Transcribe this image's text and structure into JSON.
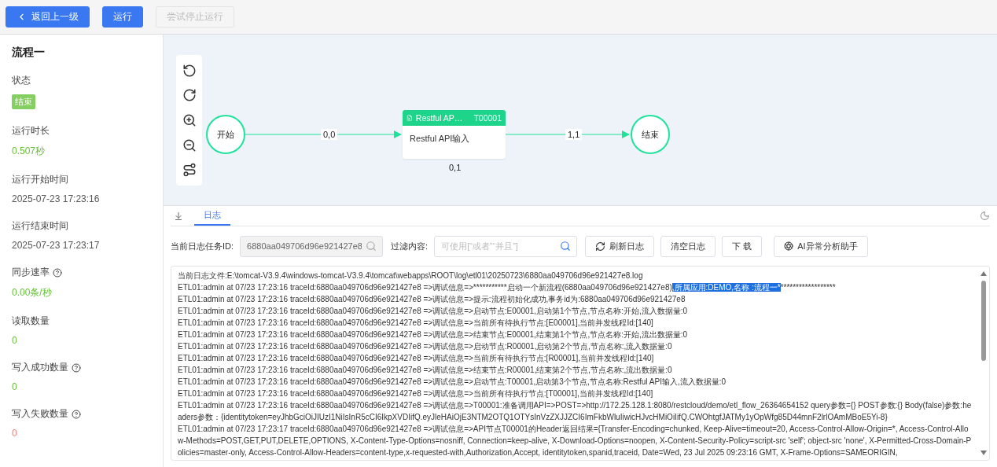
{
  "toolbar": [
    {
      "label": "返回上一级",
      "kind": "back",
      "disabled": false
    },
    {
      "label": "运行",
      "kind": "primary",
      "disabled": false
    },
    {
      "label": "尝试停止运行",
      "kind": "plain",
      "disabled": true
    }
  ],
  "flow": {
    "title": "流程一",
    "stats": [
      {
        "label": "状态",
        "help": false,
        "kind": "tag",
        "value": "结束",
        "color": "#85ce61"
      },
      {
        "label": "运行时长",
        "help": false,
        "kind": "value",
        "value": "0.507秒",
        "color": "#67c23a"
      },
      {
        "label": "运行开始时间",
        "help": false,
        "kind": "value",
        "value": "2025-07-23 17:23:16",
        "color": "#555555"
      },
      {
        "label": "运行结束时间",
        "help": false,
        "kind": "value",
        "value": "2025-07-23 17:23:17",
        "color": "#555555"
      },
      {
        "label": "同步速率",
        "help": true,
        "kind": "value",
        "value": "0.00条/秒",
        "color": "#67c23a"
      },
      {
        "label": "读取数量",
        "help": false,
        "kind": "value",
        "value": "0",
        "color": "#67c23a"
      },
      {
        "label": "写入成功数量",
        "help": true,
        "kind": "value",
        "value": "0",
        "color": "#67c23a"
      },
      {
        "label": "写入失败数量",
        "help": true,
        "kind": "value",
        "value": "0",
        "color": "#f08080"
      }
    ]
  },
  "graph": {
    "nodes": [
      {
        "kind": "start",
        "label": "开始"
      },
      {
        "kind": "task",
        "title": "Restful AP…",
        "code": "T00001",
        "body": "Restful API输入",
        "caption": "0,1"
      },
      {
        "kind": "end",
        "label": "结束"
      }
    ],
    "edges": [
      {
        "label": "0,0"
      },
      {
        "label": "1,1"
      }
    ]
  },
  "log_panel": {
    "tabs": [
      {
        "label": "日志",
        "selected": true
      }
    ],
    "task_id": {
      "label": "当前日志任务ID:",
      "value": "6880aa049706d96e921427e8",
      "disabled": true
    },
    "filter": {
      "label": "过滤内容:",
      "placeholder": "可使用[“或者”“并且”]"
    },
    "actions": [
      {
        "label": "刷新日志",
        "kind": "refresh"
      },
      {
        "label": "清空日志",
        "kind": "plain"
      },
      {
        "label": "下 载",
        "kind": "plain"
      },
      {
        "label": "AI异常分析助手",
        "kind": "ai"
      }
    ],
    "lines": [
      [
        {
          "text": "当前日志文件:E:\\tomcat-V3.9.4\\windows-tomcat-V3.9.4\\tomcat\\webapps\\ROOT\\log\\etl01\\20250723\\6880aa049706d96e921427e8.log",
          "selected": false
        }
      ],
      [
        {
          "text": "ETL01:admin at 07/23 17:23:16 traceId:6880aa049706d96e921427e8 =>调试信息=>***********启动一个新流程(6880aa049706d96e921427e8)",
          "selected": false
        },
        {
          "text": ",所属应用:DEMO,名称 :流程一*",
          "selected": true
        },
        {
          "text": "******************",
          "selected": false
        }
      ],
      [
        {
          "text": "ETL01:admin at 07/23 17:23:16 traceId:6880aa049706d96e921427e8 =>调试信息=>提示:流程初始化成功,事务id为:6880aa049706d96e921427e8",
          "selected": false
        }
      ],
      [
        {
          "text": "ETL01:admin at 07/23 17:23:16 traceId:6880aa049706d96e921427e8 =>调试信息=>启动节点:E00001,启动第1个节点,节点名称:开始,流入数据量:0",
          "selected": false
        }
      ],
      [
        {
          "text": "ETL01:admin at 07/23 17:23:16 traceId:6880aa049706d96e921427e8 =>调试信息=>当前所有待执行节点:[E00001],当前并发线程Id:[140]",
          "selected": false
        }
      ],
      [
        {
          "text": "ETL01:admin at 07/23 17:23:16 traceId:6880aa049706d96e921427e8 =>调试信息=>结束节点:E00001,结束第1个节点,节点名称:开始,流出数据量:0",
          "selected": false
        }
      ],
      [
        {
          "text": "ETL01:admin at 07/23 17:23:16 traceId:6880aa049706d96e921427e8 =>调试信息=>启动节点:R00001,启动第2个节点,节点名称:,流入数据量:0",
          "selected": false
        }
      ],
      [
        {
          "text": "ETL01:admin at 07/23 17:23:16 traceId:6880aa049706d96e921427e8 =>调试信息=>当前所有待执行节点:[R00001],当前并发线程Id:[140]",
          "selected": false
        }
      ],
      [
        {
          "text": "ETL01:admin at 07/23 17:23:16 traceId:6880aa049706d96e921427e8 =>调试信息=>结束节点:R00001,结束第2个节点,节点名称:,流出数据量:0",
          "selected": false
        }
      ],
      [
        {
          "text": "ETL01:admin at 07/23 17:23:16 traceId:6880aa049706d96e921427e8 =>调试信息=>启动节点:T00001,启动第3个节点,节点名称:Restful API输入,流入数据量:0",
          "selected": false
        }
      ],
      [
        {
          "text": "ETL01:admin at 07/23 17:23:16 traceId:6880aa049706d96e921427e8 =>调试信息=>当前所有待执行节点:[T00001],当前并发线程Id:[140]",
          "selected": false
        }
      ],
      [
        {
          "text": "ETL01:admin at 07/23 17:23:16 traceId:6880aa049706d96e921427e8 =>调试信息=>T00001:准备调用API=>POST=>http://172.25.128.1:8080/restcloud/demo/etl_flow_26364654152 query参数={} POST参数:{} Body(false)参数:headers参数：{identitytoken=eyJhbGciOiJIUzI1NiIsInR5cCI6IkpXVDIifQ.eyJleHAiOjE3NTM2OTQ1OTYsInVzZXJJZCI6ImFkbWluIiwicHJvcHMiOiIifQ.CWOhtgfJATMy1yOpWfg85D44mnF2lrlOAmMBoE5Yi-8}",
          "selected": false
        }
      ],
      [
        {
          "text": "ETL01:admin at 07/23 17:23:17 traceId:6880aa049706d96e921427e8 =>调试信息=>API节点T00001的Header返回结果={Transfer-Encoding=chunked, Keep-Alive=timeout=20, Access-Control-Allow-Origin=*, Access-Control-Allow-Methods=POST,GET,PUT,DELETE,OPTIONS, X-Content-Type-Options=nosniff, Connection=keep-alive, X-Download-Options=noopen, X-Content-Security-Policy=script-src 'self'; object-src 'none', X-Permitted-Cross-Domain-Policies=master-only, Access-Control-Allow-Headers=content-type,x-requested-with,Authorization,Accept, identitytoken,spanid,traceid, Date=Wed, 23 Jul 2025 09:23:16 GMT, X-Frame-Options=SAMEORIGIN,",
          "selected": false
        }
      ]
    ]
  }
}
